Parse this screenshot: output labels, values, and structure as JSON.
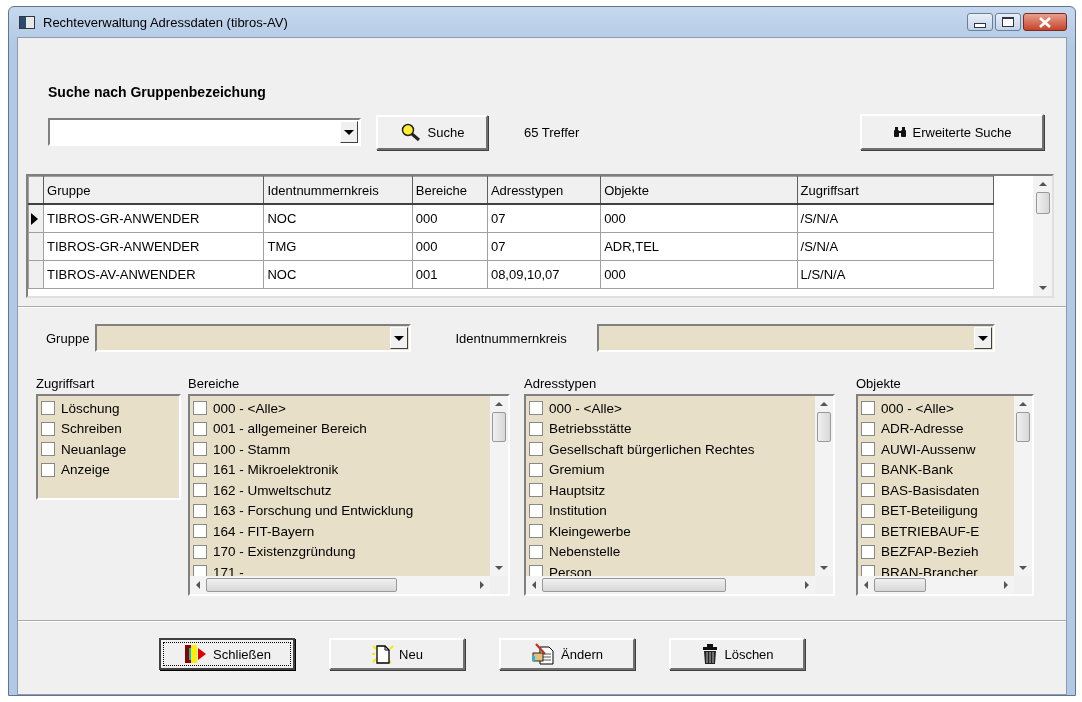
{
  "window": {
    "title": "Rechteverwaltung Adressdaten (tibros-AV)"
  },
  "search": {
    "heading": "Suche nach Gruppenbezeichung",
    "button": "Suche",
    "result_count": "65 Treffer",
    "advanced_button": "Erweiterte Suche"
  },
  "grid": {
    "columns": [
      "Gruppe",
      "Identnummernkreis",
      "Bereiche",
      "Adresstypen",
      "Objekte",
      "Zugriffsart"
    ],
    "rows": [
      {
        "selected": true,
        "cells": [
          "TIBROS-GR-ANWENDER",
          "NOC",
          "000",
          "07",
          "000",
          "/S/N/A"
        ]
      },
      {
        "selected": false,
        "cells": [
          "TIBROS-GR-ANWENDER",
          "TMG",
          "000",
          "07",
          "ADR,TEL",
          "/S/N/A"
        ]
      },
      {
        "selected": false,
        "cells": [
          "TIBROS-AV-ANWENDER",
          "NOC",
          "001",
          "08,09,10,07",
          "000",
          "L/S/N/A"
        ]
      }
    ]
  },
  "filters": {
    "group_label": "Gruppe",
    "ident_label": "Identnummernkreis"
  },
  "lists": [
    {
      "title": "Zugriffsart",
      "scrollable": false,
      "items": [
        {
          "label": "Löschung",
          "checked": false
        },
        {
          "label": "Schreiben",
          "checked": false
        },
        {
          "label": "Neuanlage",
          "checked": false
        },
        {
          "label": "Anzeige",
          "checked": false
        }
      ]
    },
    {
      "title": "Bereiche",
      "scrollable": true,
      "items": [
        {
          "label": "000 - <Alle>",
          "checked": false
        },
        {
          "label": "001 - allgemeiner Bereich",
          "checked": false
        },
        {
          "label": "100 - Stamm",
          "checked": false
        },
        {
          "label": "161 - Mikroelektronik",
          "checked": false
        },
        {
          "label": "162 - Umweltschutz",
          "checked": false
        },
        {
          "label": "163 - Forschung und Entwicklung",
          "checked": false
        },
        {
          "label": "164 - FIT-Bayern",
          "checked": false
        },
        {
          "label": "170 - Existenzgründung",
          "checked": false
        },
        {
          "label": "171 -",
          "checked": false
        }
      ]
    },
    {
      "title": "Adresstypen",
      "scrollable": true,
      "items": [
        {
          "label": "000 - <Alle>",
          "checked": false
        },
        {
          "label": "Betriebsstätte",
          "checked": false
        },
        {
          "label": "Gesellschaft bürgerlichen Rechtes",
          "checked": false
        },
        {
          "label": "Gremium",
          "checked": false
        },
        {
          "label": "Hauptsitz",
          "checked": false
        },
        {
          "label": "Institution",
          "checked": false
        },
        {
          "label": "Kleingewerbe",
          "checked": false
        },
        {
          "label": "Nebenstelle",
          "checked": false
        },
        {
          "label": "Person",
          "checked": false
        }
      ]
    },
    {
      "title": "Objekte",
      "scrollable": true,
      "items": [
        {
          "label": "000 - <Alle>",
          "checked": false
        },
        {
          "label": "ADR-Adresse",
          "checked": false
        },
        {
          "label": "AUWI-Aussenw",
          "checked": false
        },
        {
          "label": "BANK-Bank",
          "checked": false
        },
        {
          "label": "BAS-Basisdaten",
          "checked": false
        },
        {
          "label": "BET-Beteiligung",
          "checked": false
        },
        {
          "label": "BETRIEBAUF-E",
          "checked": false
        },
        {
          "label": "BEZFAP-Bezieh",
          "checked": false
        },
        {
          "label": "BRAN-Brancher",
          "checked": false
        }
      ]
    }
  ],
  "buttons": [
    {
      "label": "Schließen",
      "kind": "exit",
      "focused": true
    },
    {
      "label": "Neu",
      "kind": "new",
      "focused": false
    },
    {
      "label": "Ändern",
      "kind": "edit",
      "focused": false
    },
    {
      "label": "Löschen",
      "kind": "delete",
      "focused": false
    }
  ]
}
